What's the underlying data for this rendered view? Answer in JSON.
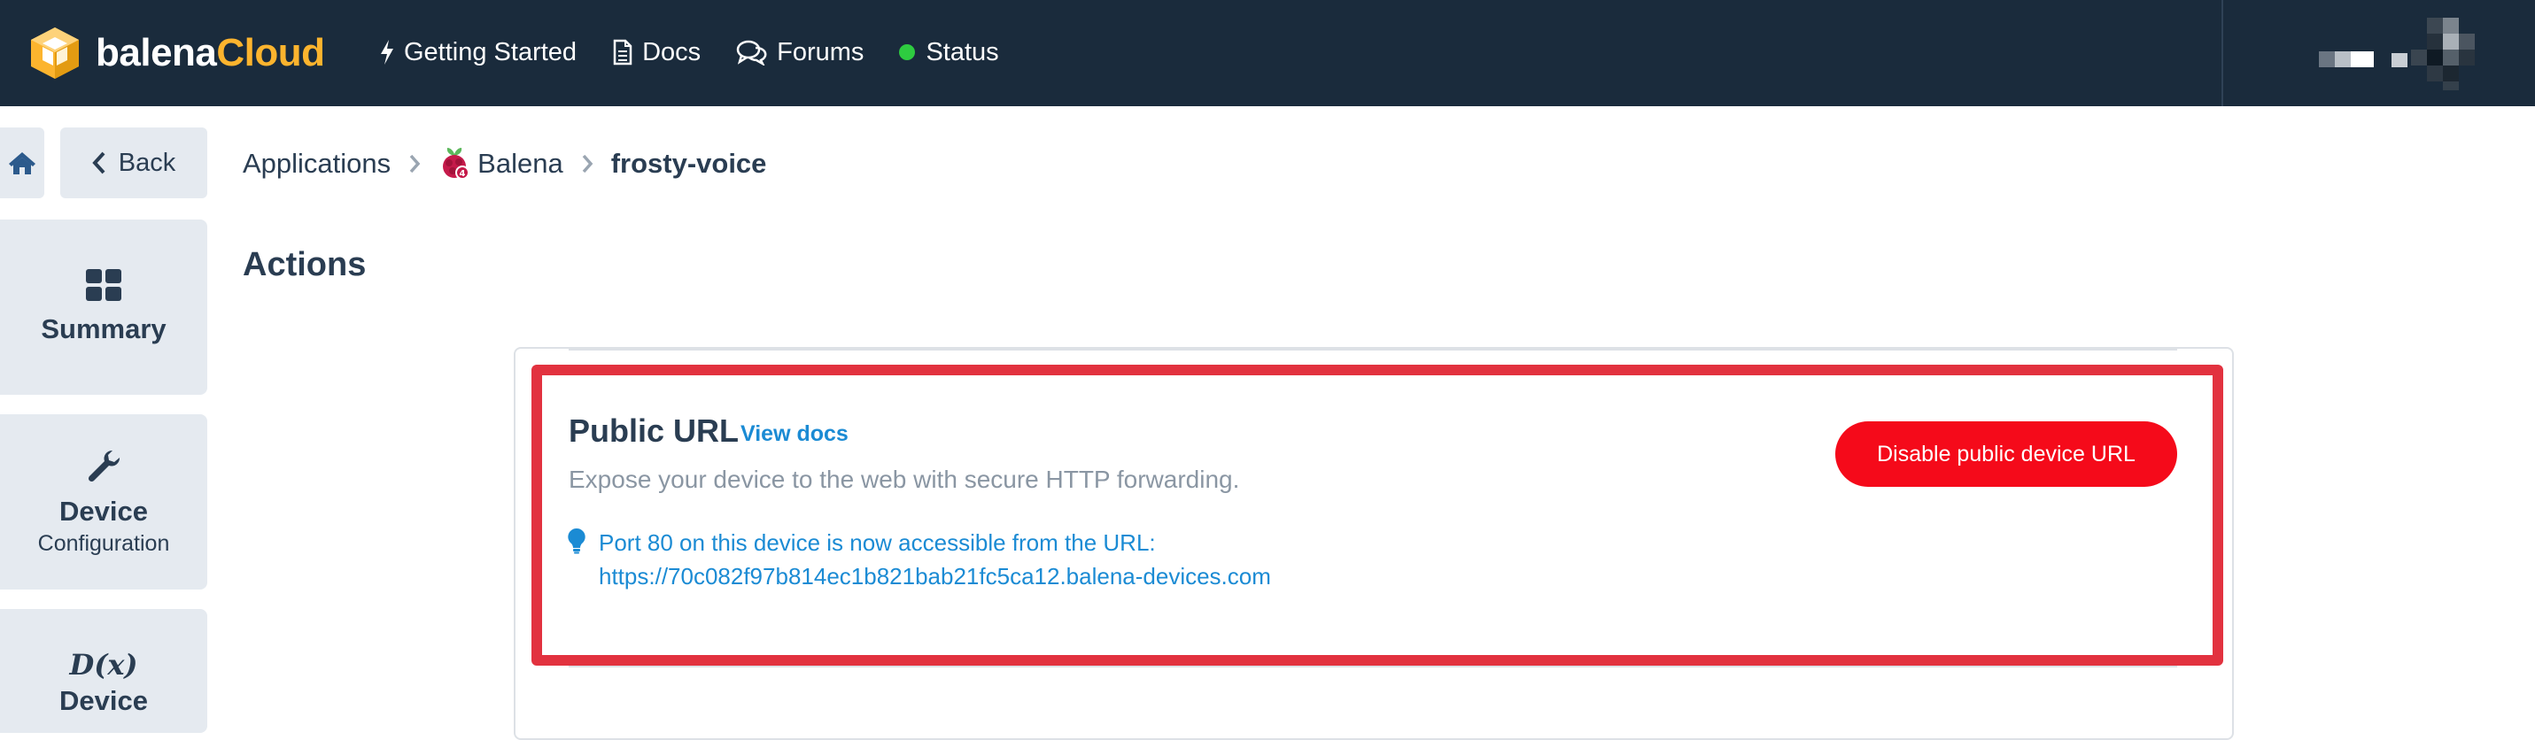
{
  "brand": {
    "word1": "balena",
    "word2": "Cloud"
  },
  "nav": {
    "getting_started": "Getting Started",
    "docs": "Docs",
    "forums": "Forums",
    "status": "Status"
  },
  "sidebar": {
    "back": "Back",
    "summary": "Summary",
    "device_config": {
      "line1": "Device",
      "line2": "Configuration"
    },
    "device_variables": {
      "icon_text": "D(x)",
      "line1": "Device"
    }
  },
  "breadcrumb": {
    "applications": "Applications",
    "app": "Balena",
    "device": "frosty-voice"
  },
  "page_title": "Actions",
  "public_url": {
    "title": "Public URL",
    "view_docs": "View docs",
    "description": "Expose your device to the web with secure HTTP forwarding.",
    "info_line": "Port 80 on this device is now accessible from the URL:",
    "url": "https://70c082f97b814ec1b821bab21fc5ca12.balena-devices.com",
    "disable_button": "Disable public device URL"
  },
  "colors": {
    "topbar": "#1a2b3c",
    "brand_accent": "#fcb42e",
    "status_ok": "#2ecc40",
    "link": "#1b8bd4",
    "danger_button": "#f50a1a",
    "highlight_border": "#e2323f",
    "sidebar_bg": "#e5eaf0"
  }
}
